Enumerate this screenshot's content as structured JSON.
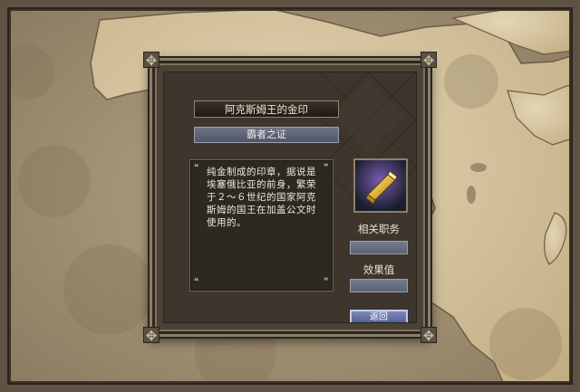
{
  "item": {
    "name": "阿克斯姆王的金印",
    "category": "霸者之证",
    "description": "纯金制成的印章，据说是埃塞俄比亚的前身，繁荣于２～６世纪的国家阿克斯姆的国王在加盖公文时使用的。",
    "icon": "gold-seal-icon"
  },
  "labels": {
    "related_position": "相关职务",
    "effect_value": "效果值"
  },
  "values": {
    "related_position": "",
    "effect_value": ""
  },
  "buttons": {
    "back": "返回"
  },
  "colors": {
    "map_parchment": "#cbb88f",
    "map_sea": "#a8967a",
    "dialog_bg": "#3e362d",
    "value_box": "#6a7084",
    "button_blue": "#5f6ca0"
  }
}
